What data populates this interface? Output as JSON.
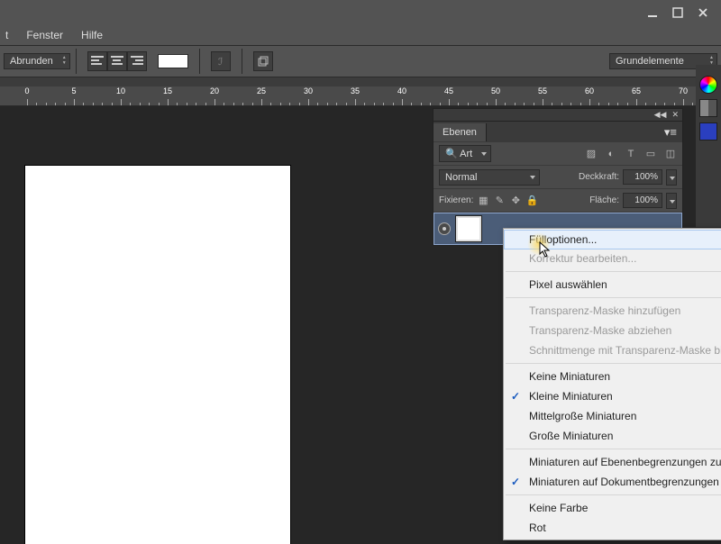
{
  "menubar": {
    "fenster": "Fenster",
    "hilfe": "Hilfe"
  },
  "optbar": {
    "shape_mode": "Abrunden",
    "presets": "Grundelemente"
  },
  "ruler_ticks": [
    "0",
    "5",
    "10",
    "15",
    "20",
    "25",
    "30",
    "35",
    "40",
    "45",
    "50",
    "55",
    "60",
    "65",
    "70"
  ],
  "panel": {
    "title": "Ebenen",
    "filter": "Art",
    "blend": "Normal",
    "opacity_label": "Deckkraft:",
    "opacity_value": "100%",
    "lock_label": "Fixieren:",
    "fill_label": "Fläche:",
    "fill_value": "100%"
  },
  "ctx": {
    "fill_options": "Fülloptionen...",
    "edit_adjust": "Korrektur bearbeiten...",
    "select_pixels": "Pixel auswählen",
    "add_mask": "Transparenz-Maske hinzufügen",
    "sub_mask": "Transparenz-Maske abziehen",
    "intersect_mask": "Schnittmenge mit Transparenz-Maske bilden",
    "no_thumb": "Keine Miniaturen",
    "small_thumb": "Kleine Miniaturen",
    "med_thumb": "Mittelgroße Miniaturen",
    "large_thumb": "Große Miniaturen",
    "clip_layer": "Miniaturen auf Ebenenbegrenzungen zuschneiden",
    "clip_doc": "Miniaturen auf Dokumentbegrenzungen zuschneiden",
    "no_color": "Keine Farbe",
    "red": "Rot"
  }
}
